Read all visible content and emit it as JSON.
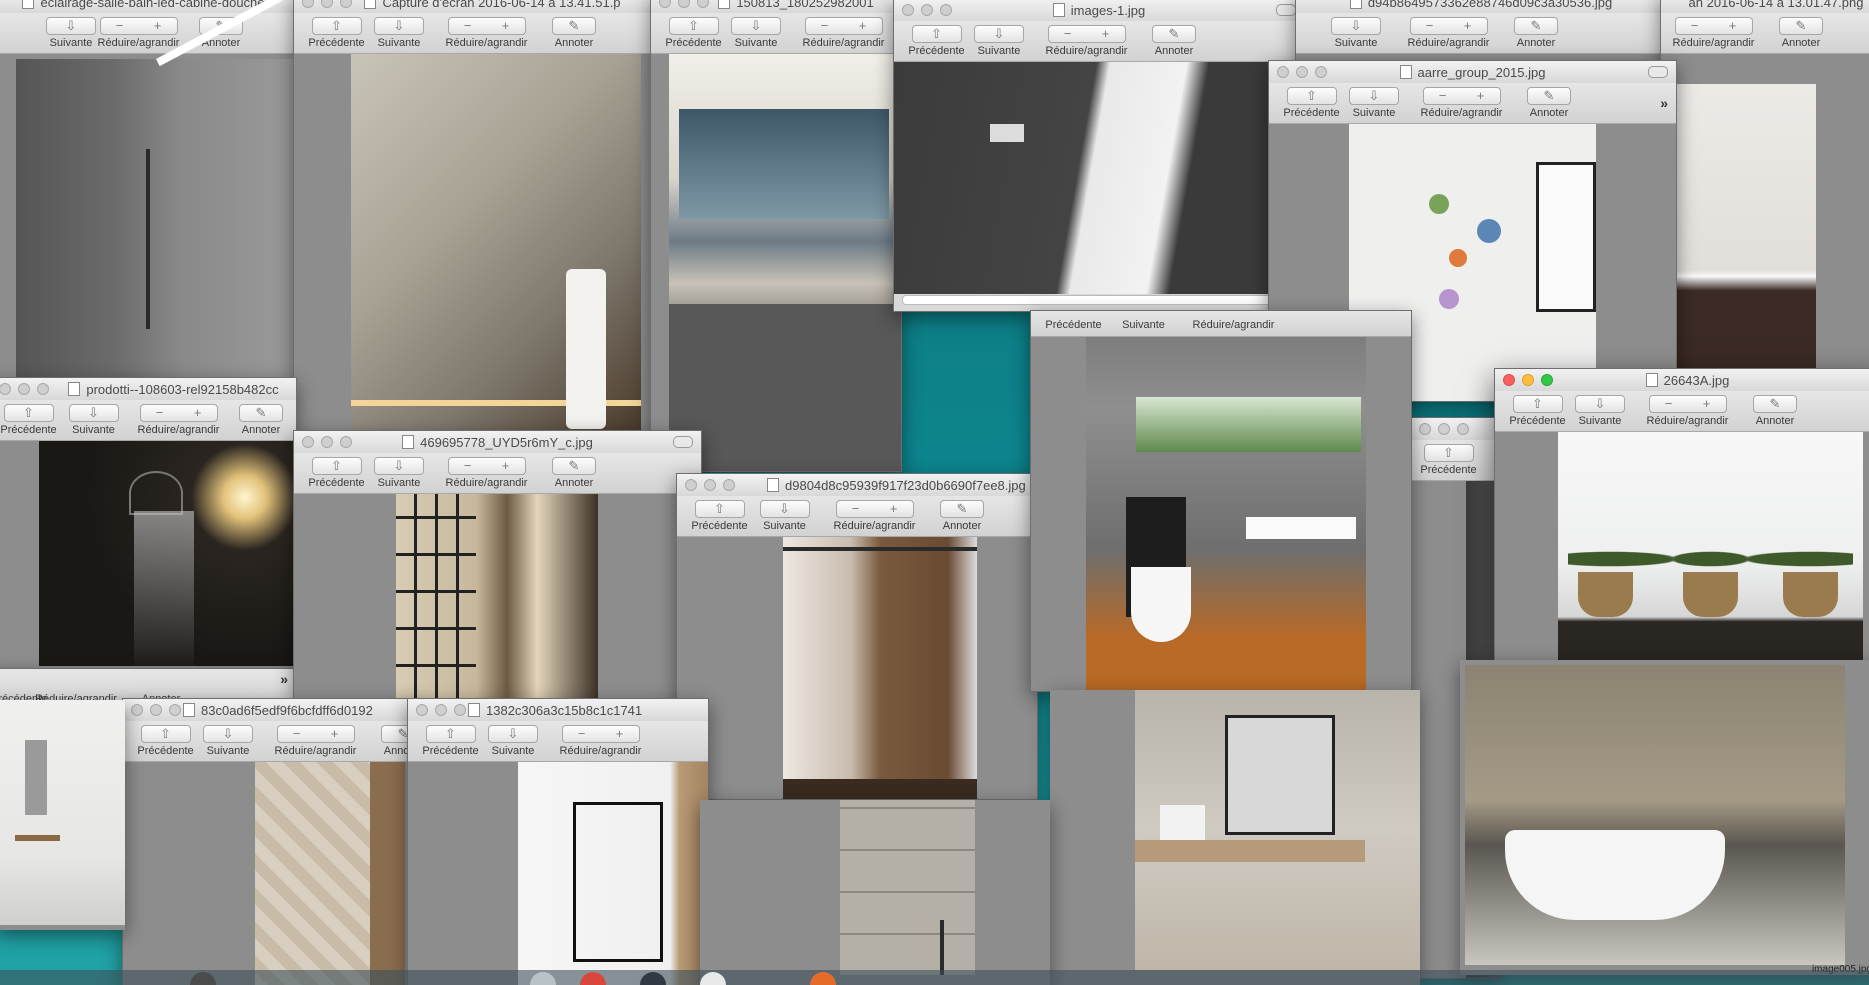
{
  "toolbar": {
    "prev": "Précédente",
    "next": "Suivante",
    "zoom": "Réduire/agrandir",
    "annotate": "Annoter",
    "overflow": "»"
  },
  "windows": {
    "w1": {
      "title": "eclairage-salle-bain-led-cabine-douche"
    },
    "w2": {
      "title": "Capture d'écran 2016-06-14 à 13.41.51.p"
    },
    "w3": {
      "title": "150813_180252982001"
    },
    "w4": {
      "title": "images-1.jpg"
    },
    "w5": {
      "title": "d94b8649573362e88746d09c3a30536.jpg"
    },
    "w6": {
      "title": "an 2016-06-14 à 13.01.47.png"
    },
    "w7": {
      "title": "aarre_group_2015.jpg"
    },
    "w8": {
      "title": "prodotti--108603-rel92158b482cc"
    },
    "w9": {
      "title": "469695778_UYD5r6mY_c.jpg"
    },
    "w10": {
      "title": "d9804d8c95939f917f23d0b6690f7ee8.jpg"
    },
    "w11": {
      "title": "26643A.jpg"
    },
    "w12": {
      "title": "83c0ad6f5edf9f6bcfdff6d0192"
    },
    "w13": {
      "title": "1382c306a3c15b8c1c1741"
    },
    "w14": {
      "title": ""
    }
  },
  "desktop": {
    "file_label": "image005.jpg"
  }
}
